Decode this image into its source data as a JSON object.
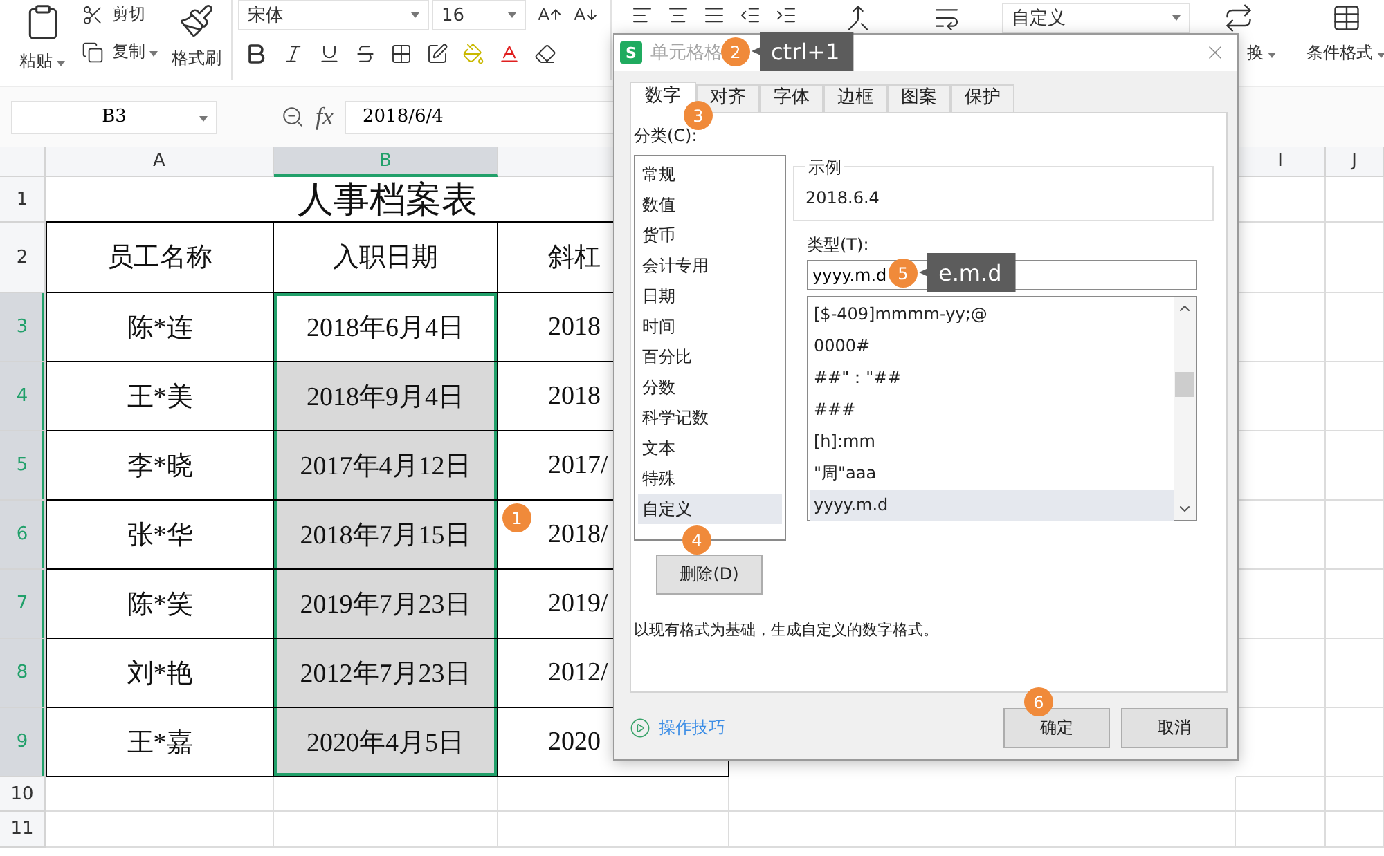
{
  "ribbon": {
    "paste": "粘贴",
    "cut": "剪切",
    "copy": "复制",
    "format_painter": "格式刷",
    "font_name": "宋体",
    "font_size": "16",
    "number_format": "自定义",
    "convert": "换",
    "conditional_format": "条件格式"
  },
  "formula_bar": {
    "cell_ref": "B3",
    "fx": "fx",
    "value": "2018/6/4"
  },
  "sheet": {
    "columns": [
      {
        "label": "A",
        "selected": false
      },
      {
        "label": "B",
        "selected": true
      },
      {
        "label": "I",
        "selected": false
      },
      {
        "label": "J",
        "selected": false
      }
    ],
    "title_row": {
      "number": "1",
      "title": "人事档案表"
    },
    "header_row": {
      "number": "2",
      "cells": [
        "员工名称",
        "入职日期",
        "斜杠"
      ]
    },
    "rows": [
      {
        "number": "3",
        "selected": true,
        "active": true,
        "cells": [
          "陈*连",
          "2018年6月4日",
          "2018"
        ]
      },
      {
        "number": "4",
        "selected": true,
        "active": false,
        "cells": [
          "王*美",
          "2018年9月4日",
          "2018"
        ]
      },
      {
        "number": "5",
        "selected": true,
        "active": false,
        "cells": [
          "李*晓",
          "2017年4月12日",
          "2017/"
        ]
      },
      {
        "number": "6",
        "selected": true,
        "active": false,
        "cells": [
          "张*华",
          "2018年7月15日",
          "2018/"
        ]
      },
      {
        "number": "7",
        "selected": true,
        "active": false,
        "cells": [
          "陈*笑",
          "2019年7月23日",
          "2019/"
        ]
      },
      {
        "number": "8",
        "selected": true,
        "active": false,
        "cells": [
          "刘*艳",
          "2012年7月23日",
          "2012/"
        ]
      },
      {
        "number": "9",
        "selected": true,
        "active": false,
        "cells": [
          "王*嘉",
          "2020年4月5日",
          "2020"
        ]
      }
    ],
    "empty_rows": [
      "10",
      "11"
    ]
  },
  "dialog": {
    "logo": "S",
    "title": "单元格格",
    "tabs": [
      {
        "label": "数字",
        "selected": true
      },
      {
        "label": "对齐",
        "selected": false
      },
      {
        "label": "字体",
        "selected": false
      },
      {
        "label": "边框",
        "selected": false
      },
      {
        "label": "图案",
        "selected": false
      },
      {
        "label": "保护",
        "selected": false
      }
    ],
    "category_label": "分类(C):",
    "categories": [
      {
        "label": "常规",
        "selected": false
      },
      {
        "label": "数值",
        "selected": false
      },
      {
        "label": "货币",
        "selected": false
      },
      {
        "label": "会计专用",
        "selected": false
      },
      {
        "label": "日期",
        "selected": false
      },
      {
        "label": "时间",
        "selected": false
      },
      {
        "label": "百分比",
        "selected": false
      },
      {
        "label": "分数",
        "selected": false
      },
      {
        "label": "科学记数",
        "selected": false
      },
      {
        "label": "文本",
        "selected": false
      },
      {
        "label": "特殊",
        "selected": false
      },
      {
        "label": "自定义",
        "selected": true
      }
    ],
    "sample_label": "示例",
    "sample": "2018.6.4",
    "type_label": "类型(T):",
    "type_value": "yyyy.m.d",
    "formats": [
      {
        "label": "[$-409]mmmm-yy;@",
        "selected": false
      },
      {
        "label": "0000#",
        "selected": false
      },
      {
        "label": "##\"：\"##",
        "selected": false
      },
      {
        "label": "###",
        "selected": false
      },
      {
        "label": "[h]:mm",
        "selected": false
      },
      {
        "label": "\"周\"aaa",
        "selected": false
      },
      {
        "label": "yyyy.m.d",
        "selected": true
      }
    ],
    "delete_button": "删除(D)",
    "description": "以现有格式为基础，生成自定义的数字格式。",
    "tips_link": "操作技巧",
    "ok": "确定",
    "cancel": "取消"
  },
  "annotations": [
    {
      "number": "1"
    },
    {
      "number": "2",
      "tip": "ctrl+1"
    },
    {
      "number": "3"
    },
    {
      "number": "4"
    },
    {
      "number": "5",
      "tip": "e.m.d"
    },
    {
      "number": "6"
    }
  ]
}
